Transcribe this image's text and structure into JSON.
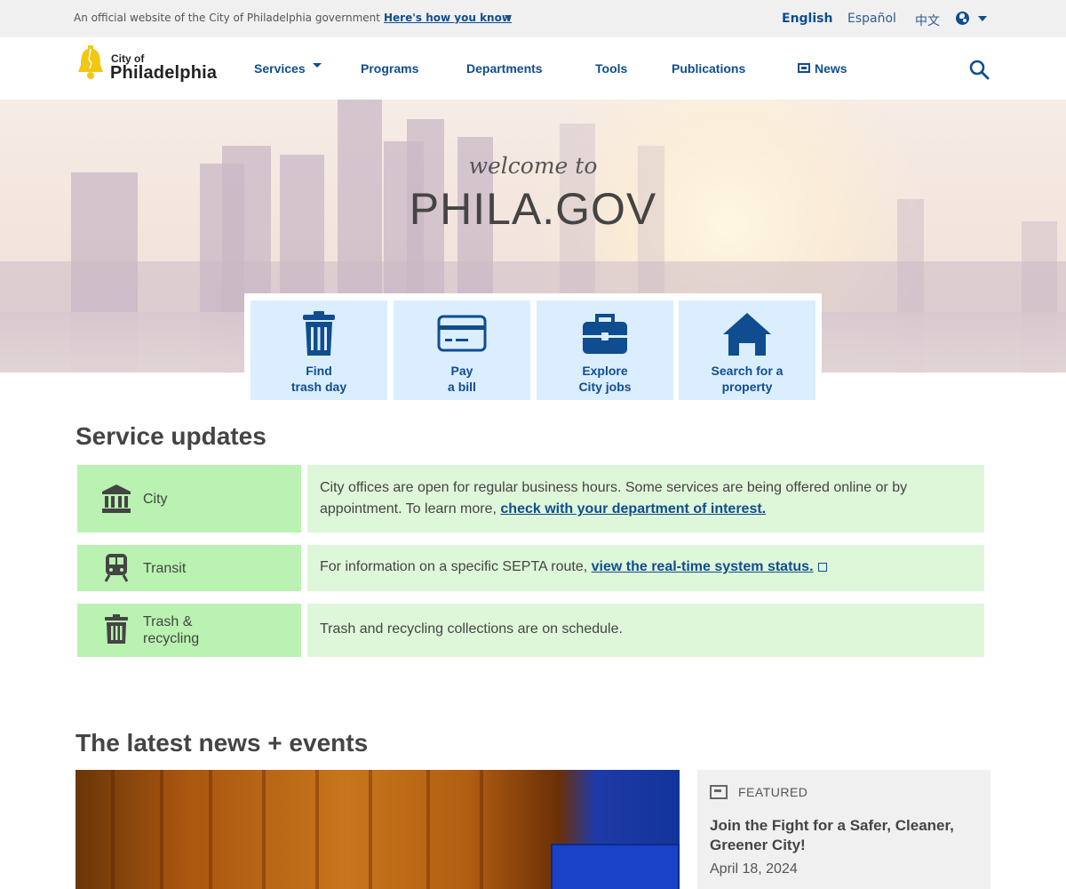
{
  "official_bar": {
    "text": "An official website of the City of Philadelphia government",
    "link": "Here's how you know",
    "languages": [
      "English",
      "Español",
      "中文"
    ]
  },
  "header": {
    "logo_top": "City of",
    "logo_main": "Philadelphia",
    "nav": [
      "Services",
      "Programs",
      "Departments",
      "Tools",
      "Publications",
      "News"
    ]
  },
  "hero": {
    "welcome": "welcome to",
    "title": "PHILA.GOV"
  },
  "tiles": [
    {
      "line1": "Find",
      "line2": "trash day",
      "icon": "trash-icon"
    },
    {
      "line1": "Pay",
      "line2": "a bill",
      "icon": "credit-card-icon"
    },
    {
      "line1": "Explore",
      "line2": "City jobs",
      "icon": "briefcase-icon"
    },
    {
      "line1": "Search for a",
      "line2": "property",
      "icon": "home-icon"
    }
  ],
  "service_updates": {
    "heading": "Service updates",
    "rows": [
      {
        "label": "City",
        "icon": "city-hall-icon",
        "text_before": "City offices are open for regular business hours. Some services are being offered online or by appointment. To learn more,",
        "link": "check with your department of interest."
      },
      {
        "label": "Transit",
        "icon": "train-icon",
        "text_before": "For information on a specific SEPTA route,",
        "link": "view the real-time system status."
      },
      {
        "label_line1": "Trash &",
        "label_line2": "recycling",
        "icon": "trash-icon",
        "text": "Trash and recycling collections are on schedule."
      }
    ]
  },
  "news": {
    "heading": "The latest news + events",
    "featured": {
      "tag": "FEATURED",
      "title": "Join the Fight for a Safer, Cleaner, Greener City!",
      "date": "April 18, 2024"
    }
  },
  "colors": {
    "brand_blue": "#0f4d90",
    "tile_bg": "#dbeeff",
    "update_label_bg": "#b9f2b1",
    "update_text_bg": "#dff7d9",
    "logo_yellow": "#f3c613"
  }
}
